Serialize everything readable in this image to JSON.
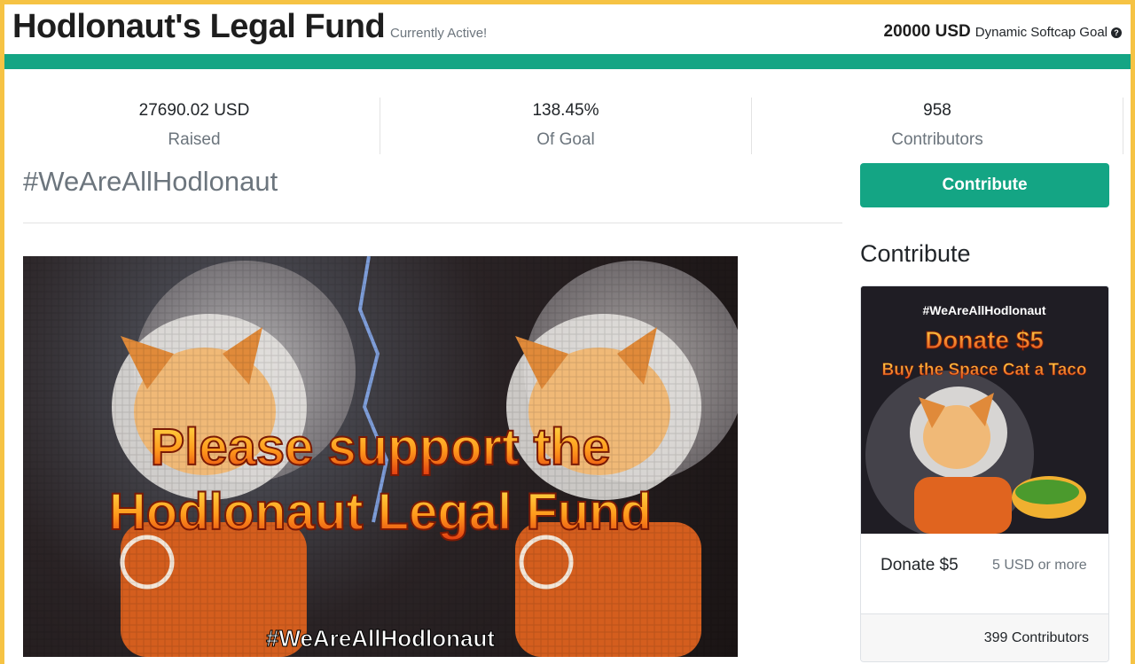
{
  "campaign": {
    "title": "Hodlonaut's Legal Fund",
    "status": "Currently Active!",
    "goal_amount": "20000 USD",
    "goal_label": "Dynamic Softcap Goal",
    "help_icon": "question-circle-icon",
    "progress_fraction": 1.0,
    "accent_color": "#14a584"
  },
  "stats": [
    {
      "value": "27690.02 USD",
      "label": "Raised"
    },
    {
      "value": "138.45%",
      "label": "Of Goal"
    },
    {
      "value": "958",
      "label": "Contributors"
    }
  ],
  "hashtag": "#WeAreAllHodlonaut",
  "contribute_button": "Contribute",
  "hero": {
    "line1": "Please support the",
    "line2": "Hodlonaut Legal Fund",
    "footer": "#WeAreAllHodlonaut"
  },
  "sidebar": {
    "title": "Contribute",
    "tier": {
      "image_tag": "#WeAreAllHodlonaut",
      "image_title": "Donate $5",
      "image_subtitle": "Buy the Space Cat a Taco",
      "name": "Donate $5",
      "minimum": "5 USD or more",
      "contributors": "399 Contributors"
    }
  }
}
